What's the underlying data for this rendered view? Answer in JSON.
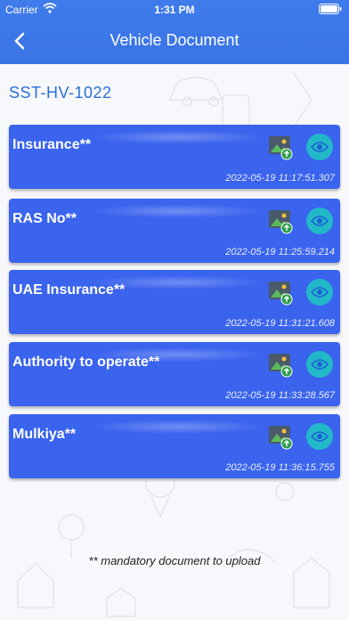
{
  "status_bar": {
    "carrier": "Carrier",
    "time": "1:31 PM"
  },
  "header": {
    "title": "Vehicle Document"
  },
  "vehicle": {
    "id": "SST-HV-1022"
  },
  "documents": [
    {
      "name": "Insurance**",
      "timestamp": "2022-05-19 11:17:51.307"
    },
    {
      "name": "RAS No**",
      "timestamp": "2022-05-19 11:25:59.214"
    },
    {
      "name": "UAE Insurance**",
      "timestamp": "2022-05-19 11:31:21.608"
    },
    {
      "name": "Authority to operate**",
      "timestamp": "2022-05-19 11:33:28.567"
    },
    {
      "name": "Mulkiya**",
      "timestamp": "2022-05-19 11:36:15.755"
    }
  ],
  "footer": {
    "note": "** mandatory document to upload"
  },
  "colors": {
    "header": "#3f7bea",
    "card": "#3a63ee",
    "view_button": "#22b8c8",
    "vehicle_id": "#2a6fd6"
  },
  "icons": {
    "back": "chevron-left-icon",
    "upload": "image-upload-icon",
    "view": "eye-icon"
  }
}
